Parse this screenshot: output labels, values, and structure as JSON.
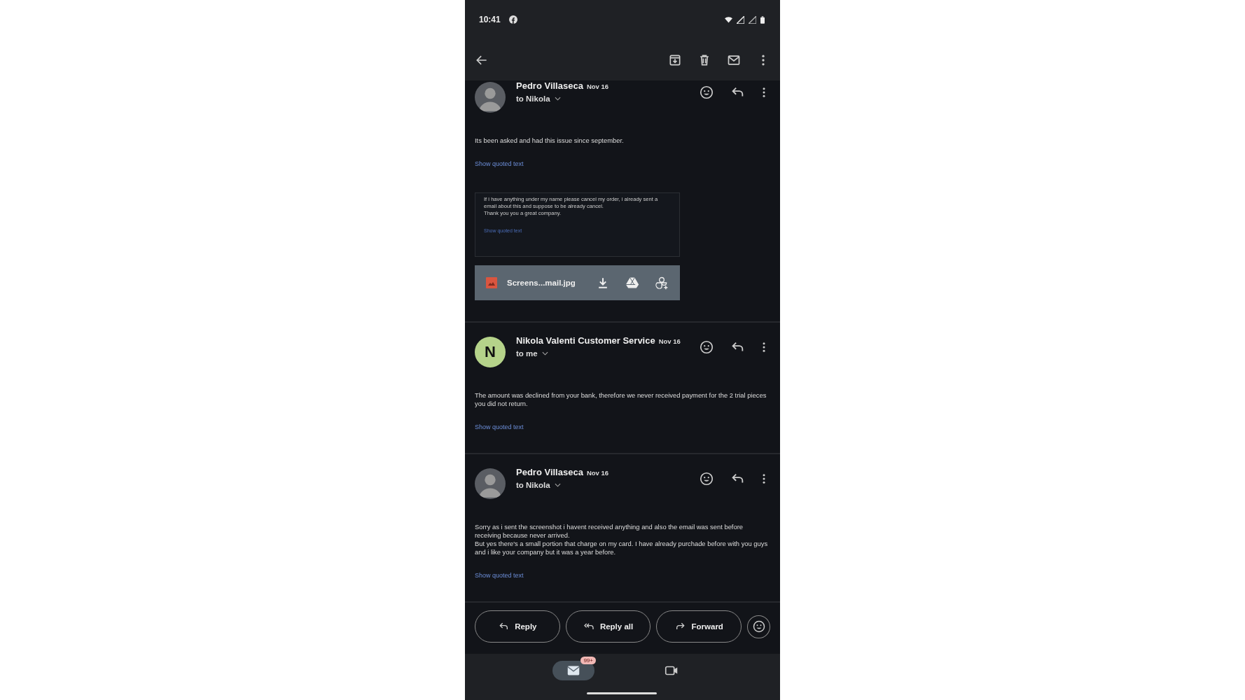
{
  "status_bar": {
    "time": "10:41"
  },
  "messages": [
    {
      "sender": "Pedro Villaseca",
      "date": "Nov 16",
      "recipient": "to Nikola",
      "avatar": {
        "kind": "photo"
      },
      "body": [
        "Its been asked and had this issue since september."
      ],
      "show_quoted": "Show quoted text",
      "attachment": {
        "preview_lines": [
          "If i have anything under my name please cancel my order, i already sent a email about this and suppose to be already cancel.",
          "Thank you you a great company."
        ],
        "preview_link": "Show quoted text",
        "filename": "Screens...mail.jpg"
      }
    },
    {
      "sender": "Nikola Valenti Customer Service",
      "date": "Nov 16",
      "recipient": "to me",
      "avatar": {
        "kind": "letter",
        "letter": "N"
      },
      "body": [
        "The amount was declined from your bank, therefore we never received payment for the 2 trial pieces you did not return."
      ],
      "show_quoted": "Show quoted text"
    },
    {
      "sender": "Pedro Villaseca",
      "date": "Nov 16",
      "recipient": "to Nikola",
      "avatar": {
        "kind": "photo"
      },
      "body": [
        "Sorry as i sent the screenshot i havent received anything and also the email was sent before receiving because never arrived.",
        "But yes there's a small portion that charge on my card. I have already purchade before with you guys and i like your company but it was a year before."
      ],
      "show_quoted": "Show quoted text"
    }
  ],
  "actions": [
    {
      "kind": "reply",
      "label": "Reply"
    },
    {
      "kind": "reply_all",
      "label": "Reply all"
    },
    {
      "kind": "forward",
      "label": "Forward"
    }
  ],
  "bottom_nav": [
    {
      "kind": "mail",
      "selected": true,
      "badge": "99+"
    },
    {
      "kind": "video",
      "selected": false
    }
  ]
}
